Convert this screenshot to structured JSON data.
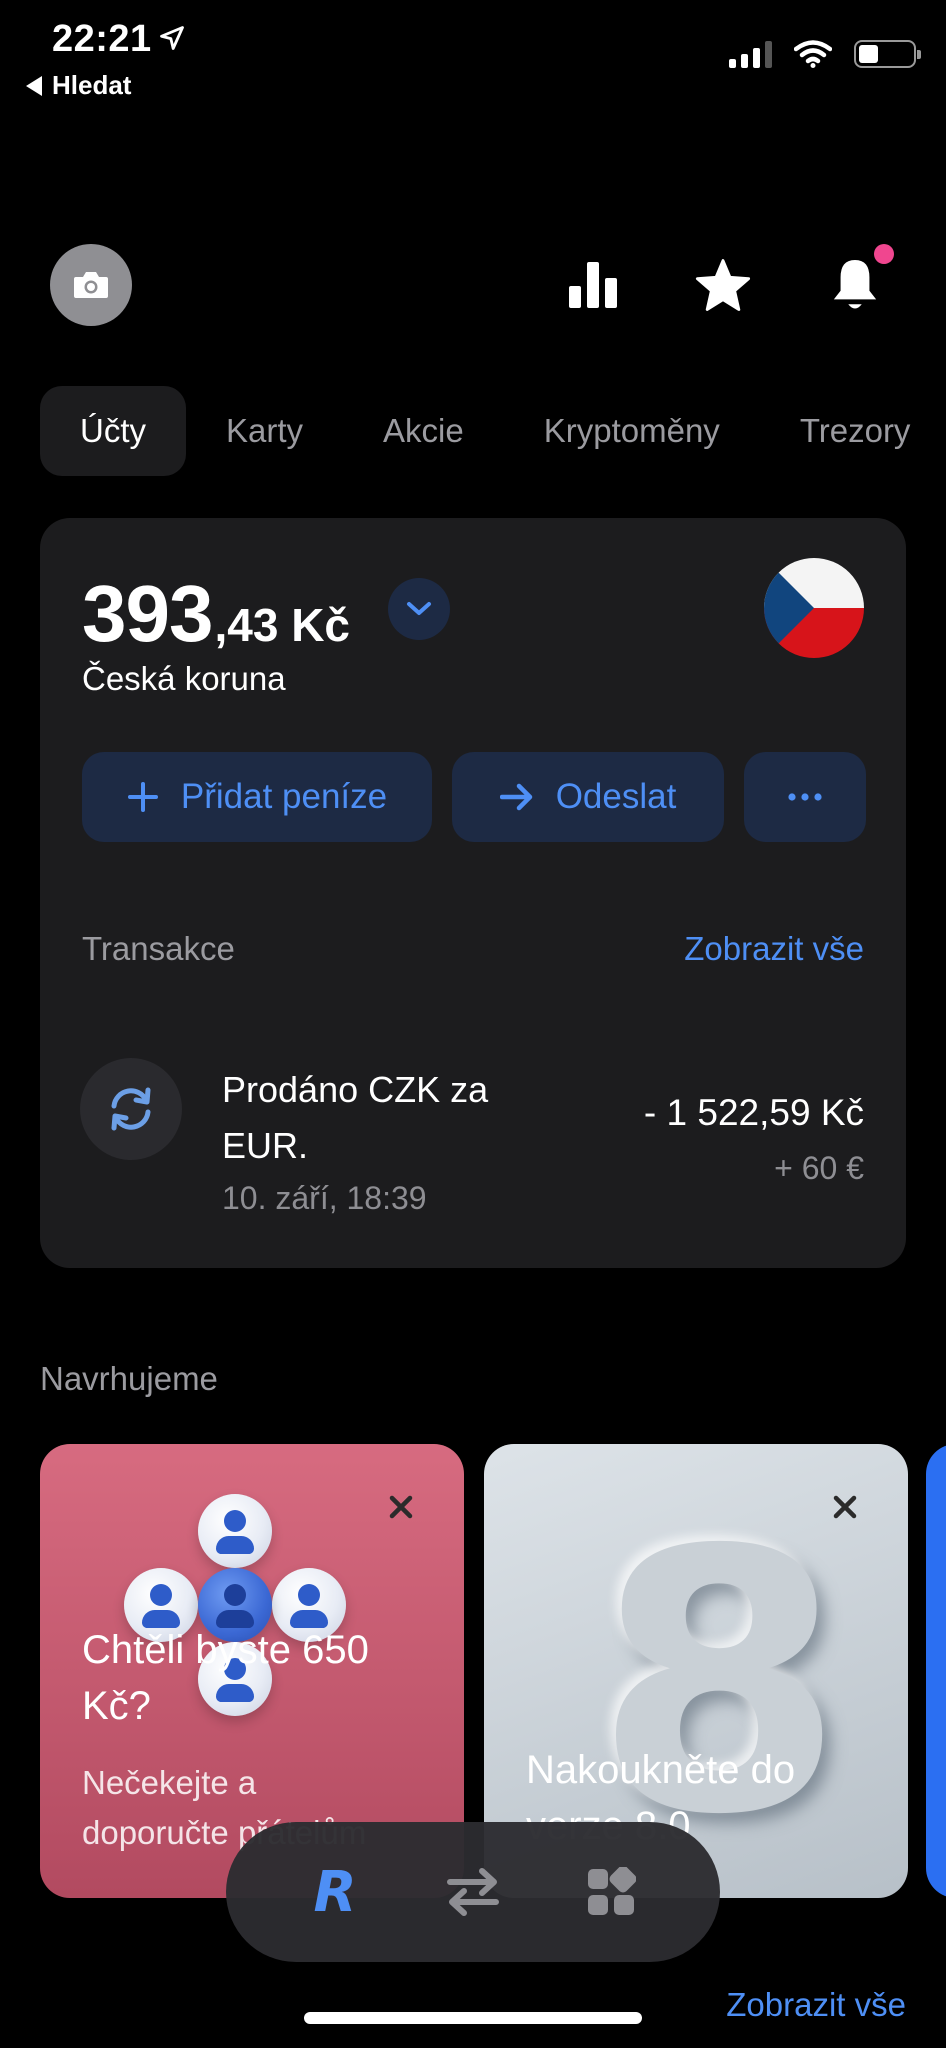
{
  "status_bar": {
    "time": "22:21",
    "back_label": "Hledat"
  },
  "tabs": [
    {
      "label": "Účty",
      "active": true
    },
    {
      "label": "Karty",
      "active": false
    },
    {
      "label": "Akcie",
      "active": false
    },
    {
      "label": "Kryptoměny",
      "active": false
    },
    {
      "label": "Trezory",
      "active": false
    }
  ],
  "account": {
    "balance_int": "393",
    "balance_rest": ",43 Kč",
    "currency_name": "Česká koruna",
    "actions": {
      "add": "Přidat peníze",
      "send": "Odeslat",
      "more": "···"
    }
  },
  "transactions": {
    "title": "Transakce",
    "view_all": "Zobrazit vše",
    "items": [
      {
        "name": "Prodáno CZK za EUR.",
        "date": "10. září, 18:39",
        "amount": "- 1 522,59 Kč",
        "sub_amount": "+ 60 €"
      }
    ]
  },
  "suggestions": {
    "title": "Navrhujeme",
    "cards": [
      {
        "title": "Chtěli byste 650 Kč?",
        "subtitle": "Nečekejte a doporučte přátelům"
      },
      {
        "title": "Nakoukněte do verze 8.0",
        "badge": "8"
      }
    ],
    "view_all": "Zobrazit vše"
  },
  "nav": {
    "home_glyph": "R"
  },
  "colors": {
    "accent": "#4e8ff5",
    "card_bg": "#1c1c1e",
    "notif_dot": "#f0468f"
  }
}
